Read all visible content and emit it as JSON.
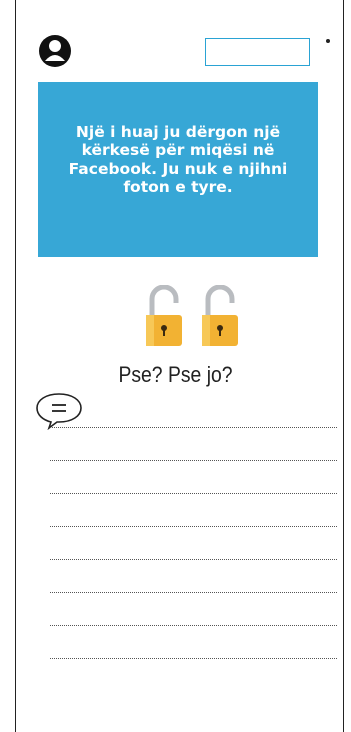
{
  "header": {
    "user_icon": "user-icon",
    "name_field_value": ""
  },
  "banner": {
    "text": "Një i huaj ju dërgon një kërkesë për miqësi në Facebook. Ju nuk e njihni foton e tyre.",
    "background_color": "#37a7d6"
  },
  "icons": {
    "lock_left": "open-padlock-icon",
    "lock_right": "open-padlock-icon",
    "speech": "speech-bubble-icon"
  },
  "question": "Pse? Pse jo?",
  "answer_lines_count": 8
}
